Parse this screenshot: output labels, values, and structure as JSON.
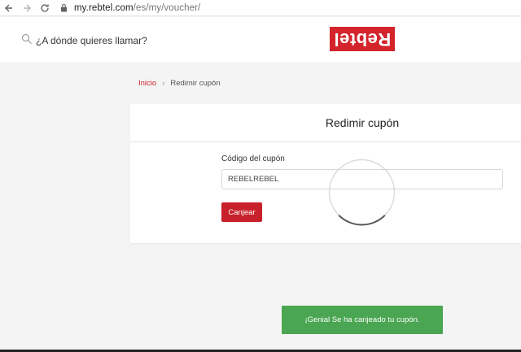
{
  "browser": {
    "url_host": "my.rebtel.com",
    "url_path": "/es/my/voucher/"
  },
  "header": {
    "search_placeholder": "¿A dónde quieres llamar?",
    "logo_text": "Rebtel",
    "logo_color": "#d4232a"
  },
  "breadcrumb": {
    "home": "Inicio",
    "separator": "›",
    "current": "Redimir cupón"
  },
  "card": {
    "title": "Redimir cupón",
    "field_label": "Código del cupón",
    "coupon_value": "REBELREBEL",
    "button_label": "Canjear",
    "button_color": "#c8212b"
  },
  "toast": {
    "message": "¡Genial Se ha canjeado tu cupón.",
    "color": "#4aa652"
  }
}
